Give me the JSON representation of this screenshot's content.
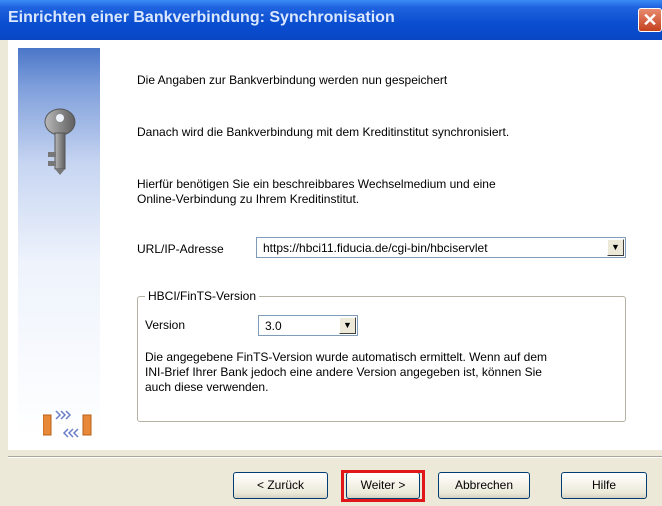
{
  "window": {
    "title": "Einrichten einer Bankverbindung: Synchronisation",
    "close_glyph": "✕"
  },
  "icons": {
    "key": "key-icon",
    "sync": "sync-transfer-icon",
    "close": "close-icon"
  },
  "content": {
    "line1": "Die Angaben zur Bankverbindung werden nun gespeichert",
    "line2": "Danach wird die Bankverbindung mit dem Kreditinstitut synchronisiert.",
    "line3a": "Hierfür benötigen Sie ein beschreibbares Wechselmedium und eine",
    "line3b": "Online-Verbindung zu Ihrem Kreditinstitut."
  },
  "url": {
    "label": "URL/IP-Adresse",
    "value": "https://hbci11.fiducia.de/cgi-bin/hbciservlet"
  },
  "fints": {
    "group_title": "HBCI/FinTS-Version",
    "version_label": "Version",
    "version_value": "3.0",
    "info_line1": "Die angegebene FinTS-Version wurde automatisch ermittelt. Wenn auf dem",
    "info_line2": "INI-Brief Ihrer Bank jedoch eine andere Version angegeben ist, können Sie",
    "info_line3": "auch diese verwenden."
  },
  "buttons": {
    "back": "< Zurück",
    "next": "Weiter >",
    "cancel": "Abbrechen",
    "help": "Hilfe"
  },
  "colors": {
    "titlebar": "#0a4ed0",
    "highlight": "#e0161b",
    "dialog_bg": "#ece9d8"
  }
}
